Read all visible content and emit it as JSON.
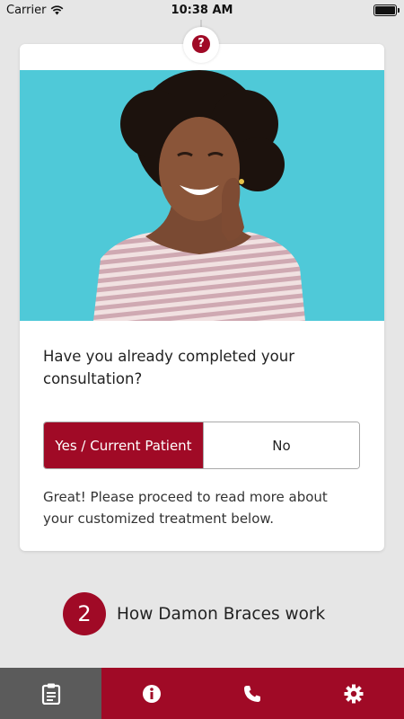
{
  "status_bar": {
    "carrier": "Carrier",
    "time": "10:38 AM"
  },
  "card": {
    "help_icon": "question-icon",
    "help_glyph": "?",
    "photo_icon": "woman-thinking-photo",
    "question": "Have you already completed your consultation?",
    "options": {
      "yes": "Yes / Current Patient",
      "no": "No",
      "selected": "yes"
    },
    "note": "Great! Please proceed to read more about your customized treatment below."
  },
  "step": {
    "number": "2",
    "label": "How Damon Braces work"
  },
  "tabbar": {
    "tabs": [
      {
        "icon": "clipboard-icon",
        "active": true
      },
      {
        "icon": "info-icon",
        "active": false
      },
      {
        "icon": "phone-icon",
        "active": false
      },
      {
        "icon": "gear-icon",
        "active": false
      }
    ]
  },
  "colors": {
    "brand": "#a00a26",
    "active_tab": "#5b5b5b",
    "background": "#e6e6e6"
  }
}
